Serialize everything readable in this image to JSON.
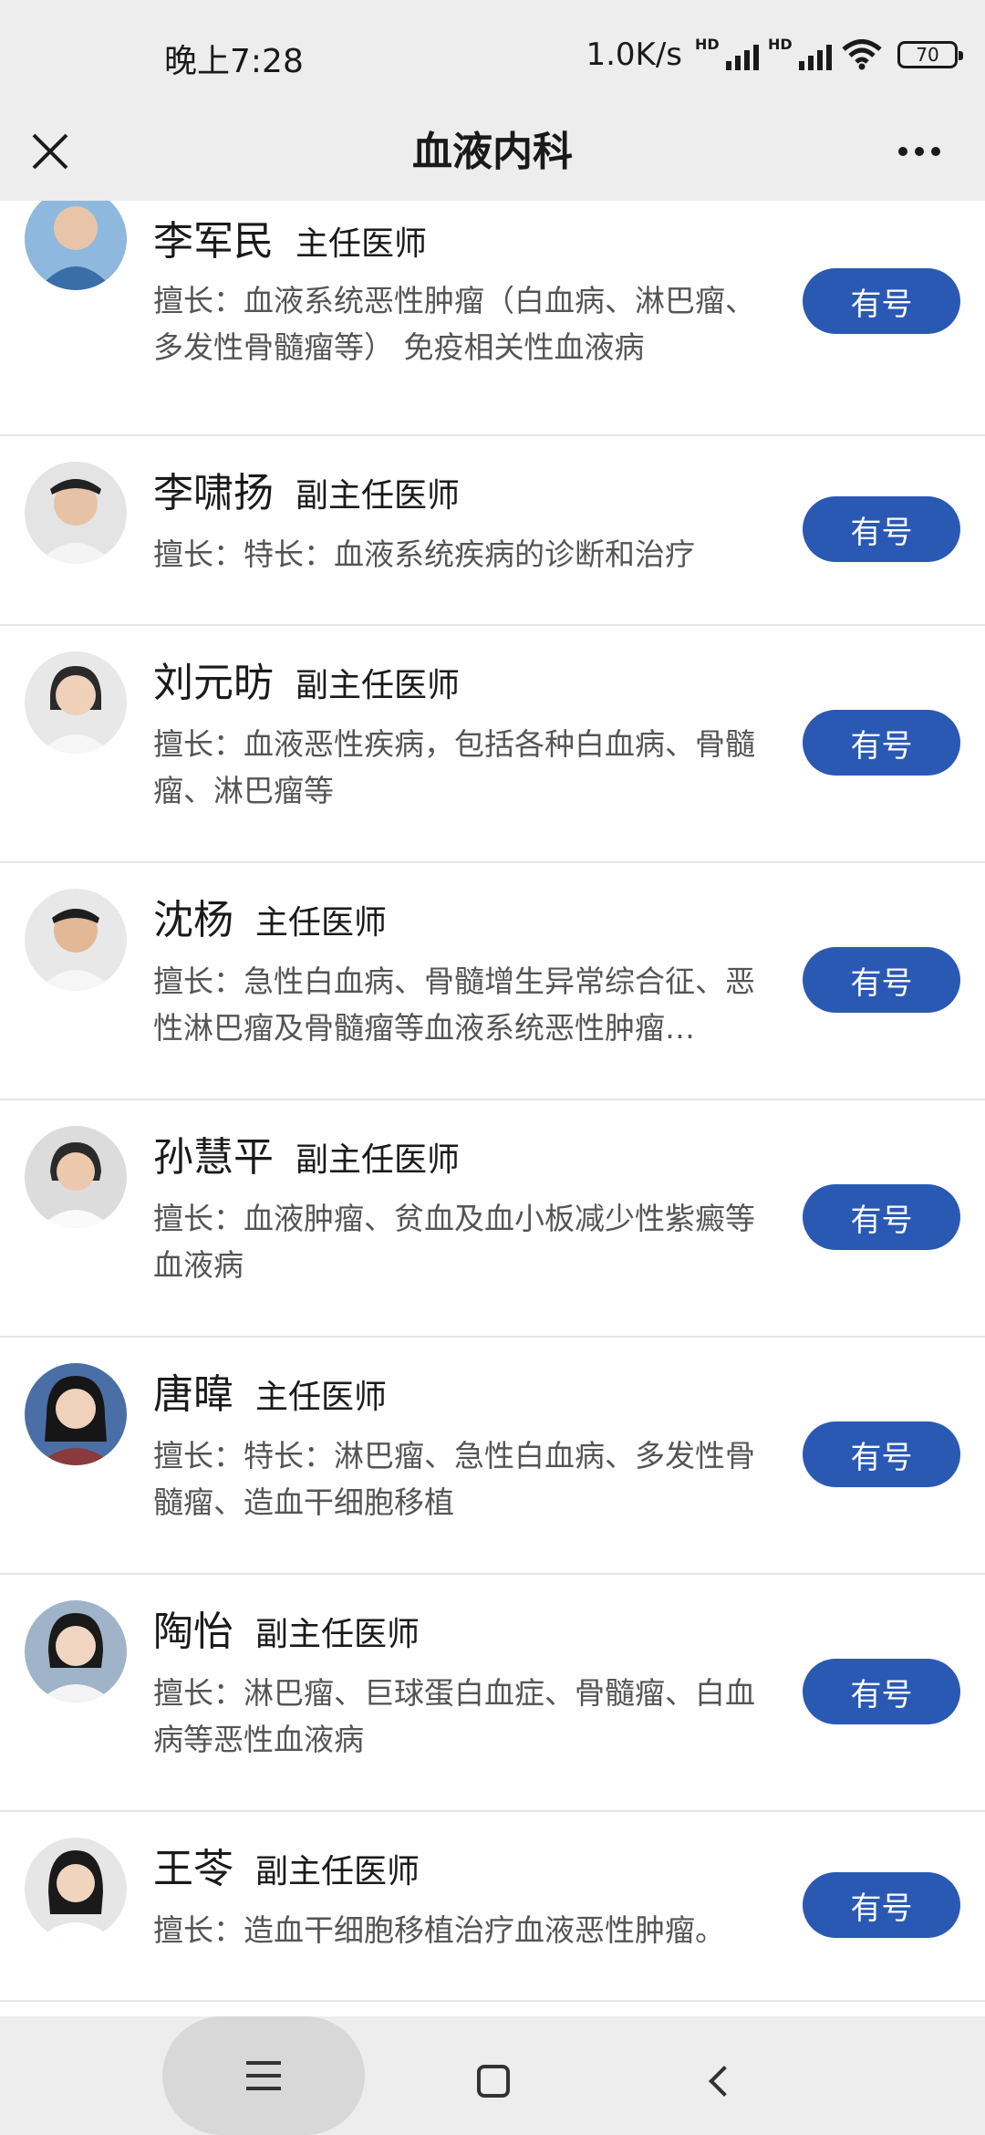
{
  "status_bar": {
    "time": "晚上7:28",
    "net_speed": "1.0K/s",
    "sim1_label": "HD",
    "sim2_label": "HD",
    "battery": "70"
  },
  "nav": {
    "title": "血液内科",
    "close_icon": "close-icon",
    "more_icon": "more-dots-icon"
  },
  "book_label": "有号",
  "doctors": [
    {
      "name": "李军民",
      "title": "主任医师",
      "desc": "擅长：血液系统恶性肿瘤（白血病、淋巴瘤、多发性骨髓瘤等） 免疫相关性血液病"
    },
    {
      "name": "李啸扬",
      "title": "副主任医师",
      "desc": "擅长：特长：血液系统疾病的诊断和治疗"
    },
    {
      "name": "刘元昉",
      "title": "副主任医师",
      "desc": "擅长：血液恶性疾病，包括各种白血病、骨髓瘤、淋巴瘤等"
    },
    {
      "name": "沈杨",
      "title": "主任医师",
      "desc": "擅长：急性白血病、骨髓增生异常综合征、恶性淋巴瘤及骨髓瘤等血液系统恶性肿瘤…"
    },
    {
      "name": "孙慧平",
      "title": "副主任医师",
      "desc": "擅长：血液肿瘤、贫血及血小板减少性紫癜等血液病"
    },
    {
      "name": "唐暐",
      "title": "主任医师",
      "desc": "擅长：特长：淋巴瘤、急性白血病、多发性骨髓瘤、造血干细胞移植"
    },
    {
      "name": "陶怡",
      "title": "副主任医师",
      "desc": "擅长：淋巴瘤、巨球蛋白血症、骨髓瘤、白血病等恶性血液病"
    },
    {
      "name": "王苓",
      "title": "副主任医师",
      "desc": "擅长：造血干细胞移植治疗血液恶性肿瘤。"
    }
  ],
  "bottom_nav": {
    "menu_icon": "menu-icon",
    "home_icon": "home-icon",
    "back_icon": "back-icon"
  }
}
